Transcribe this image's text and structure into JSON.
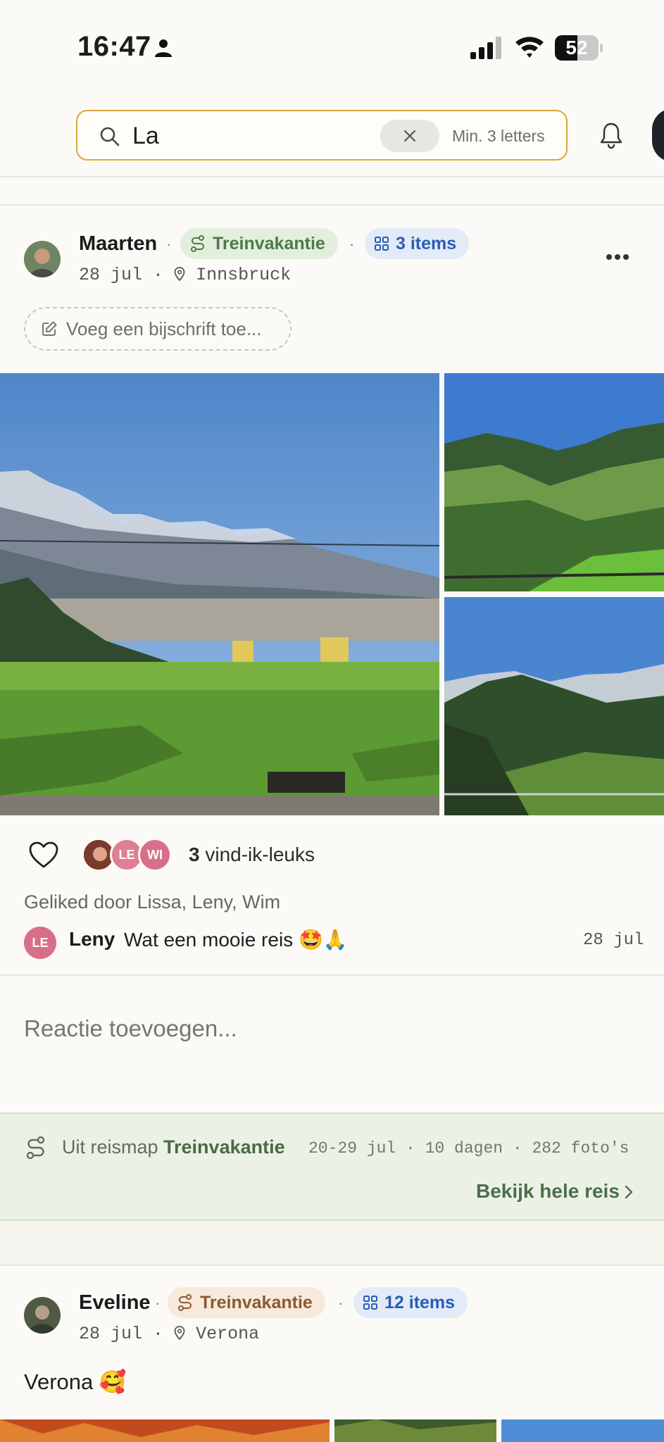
{
  "status_bar": {
    "time": "16:47",
    "battery": "52",
    "battery_level": 0.52
  },
  "search": {
    "value": "La",
    "placeholder": "Zoeken",
    "hint": "Min. 3 letters"
  },
  "post1": {
    "author": "Maarten",
    "trip_chip": "Treinvakantie",
    "items_chip": "3 items",
    "date": "28 jul",
    "location": "Innsbruck",
    "caption_placeholder": "Voeg een bijschrift toe...",
    "likers": [
      "",
      "LE",
      "WI"
    ],
    "likes_count": "3",
    "likes_label": " vind-ik-leuks",
    "liked_by": "Geliked door Lissa, Leny, Wim",
    "comment": {
      "avatar": "LE",
      "author": "Leny",
      "text": "Wat een mooie reis 🤩🙏",
      "date": "28 jul"
    },
    "reply_placeholder": "Reactie toevoegen..."
  },
  "trip_banner": {
    "prefix": "Uit reismap ",
    "trip_name": "Treinvakantie",
    "meta": "20-29 jul · 10 dagen · 282 foto's",
    "link": "Bekijk hele reis"
  },
  "post2": {
    "author": "Eveline",
    "trip_chip": "Treinvakantie",
    "items_chip": "12 items",
    "date": "28 jul",
    "location": "Verona",
    "caption": "Verona 🥰"
  },
  "colors": {
    "accent_search": "#d8a93a",
    "chip_green": "#4d7a49",
    "chip_blue": "#2a5db7",
    "chip_orange": "#8a5a33"
  }
}
